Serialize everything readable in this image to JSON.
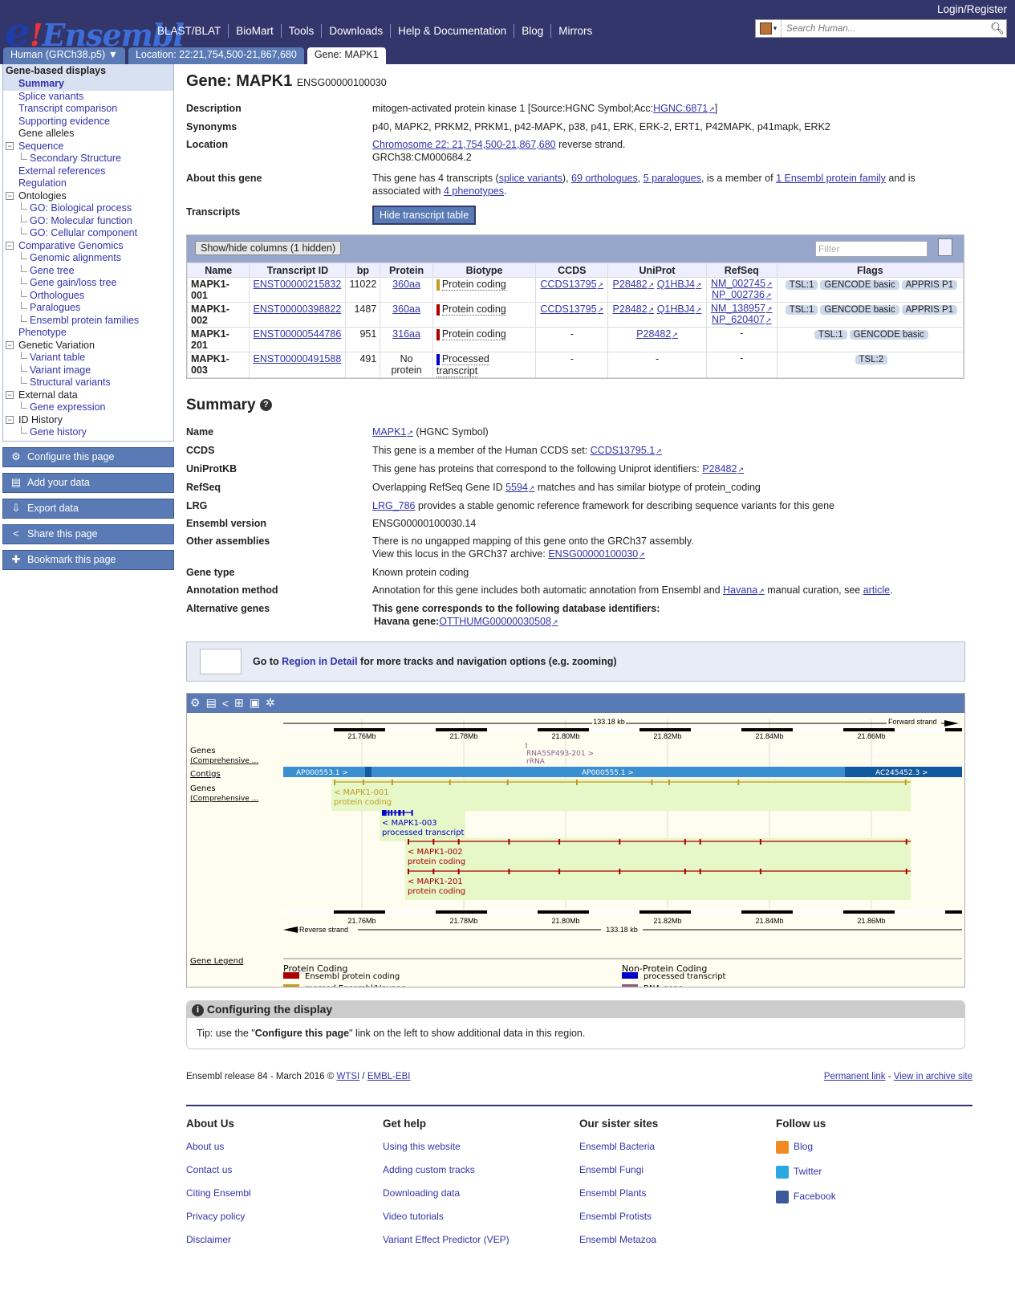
{
  "header": {
    "logo_e": "e",
    "logo_bang": "!",
    "logo_text": "Ensembl",
    "login": "Login/Register",
    "search_placeholder": "Search Human...",
    "nav": [
      "BLAST/BLAT",
      "BioMart",
      "Tools",
      "Downloads",
      "Help & Documentation",
      "Blog",
      "Mirrors"
    ],
    "tabs": [
      "Human (GRCh38.p5) ▼",
      "Location: 22:21,754,500-21,867,680",
      "Gene: MAPK1"
    ]
  },
  "sidebar": {
    "heading": "Gene-based displays",
    "items": [
      {
        "label": "Summary",
        "level": 1,
        "selected": true
      },
      {
        "label": "Splice variants",
        "level": 1
      },
      {
        "label": "Transcript comparison",
        "level": 1
      },
      {
        "label": "Supporting evidence",
        "level": 1
      },
      {
        "label": "Gene alleles",
        "level": 1,
        "plain": true
      },
      {
        "label": "Sequence",
        "level": 1,
        "toggle": "−"
      },
      {
        "label": "Secondary Structure",
        "level": 2,
        "plain": true
      },
      {
        "label": "External references",
        "level": 1
      },
      {
        "label": "Regulation",
        "level": 1
      },
      {
        "label": "Ontologies",
        "level": 1,
        "toggle": "−",
        "plain": true
      },
      {
        "label": "GO: Biological process",
        "level": 2
      },
      {
        "label": "GO: Molecular function",
        "level": 2
      },
      {
        "label": "GO: Cellular component",
        "level": 2
      },
      {
        "label": "Comparative Genomics",
        "level": 1,
        "toggle": "−"
      },
      {
        "label": "Genomic alignments",
        "level": 2
      },
      {
        "label": "Gene tree",
        "level": 2
      },
      {
        "label": "Gene gain/loss tree",
        "level": 2
      },
      {
        "label": "Orthologues",
        "level": 2
      },
      {
        "label": "Paralogues",
        "level": 2
      },
      {
        "label": "Ensembl protein families",
        "level": 2
      },
      {
        "label": "Phenotype",
        "level": 1
      },
      {
        "label": "Genetic Variation",
        "level": 1,
        "toggle": "−",
        "plain": true
      },
      {
        "label": "Variant table",
        "level": 2
      },
      {
        "label": "Variant image",
        "level": 2
      },
      {
        "label": "Structural variants",
        "level": 2
      },
      {
        "label": "External data",
        "level": 1,
        "toggle": "−",
        "plain": true
      },
      {
        "label": "Gene expression",
        "level": 2
      },
      {
        "label": "ID History",
        "level": 1,
        "toggle": "−",
        "plain": true
      },
      {
        "label": "Gene history",
        "level": 2
      }
    ],
    "buttons": [
      {
        "label": "Configure this page",
        "icon": "⚙"
      },
      {
        "label": "Add your data",
        "icon": "▤"
      },
      {
        "label": "Export data",
        "icon": "⇩"
      },
      {
        "label": "Share this page",
        "icon": "<"
      },
      {
        "label": "Bookmark this page",
        "icon": "✚"
      }
    ]
  },
  "gene": {
    "title": "Gene: MAPK1",
    "id": "ENSG00000100030",
    "description_text": "mitogen-activated protein kinase 1 [Source:HGNC Symbol;Acc:",
    "description_link": "HGNC:6871",
    "description_end": "]",
    "synonyms": "p40, MAPK2, PRKM2, PRKM1, p42-MAPK, p38, p41, ERK, ERK-2, ERT1, P42MAPK, p41mapk, ERK2",
    "location_link": "Chromosome 22: 21,754,500-21,867,680",
    "location_strand": " reverse strand.",
    "assembly": "GRCh38:CM000684.2",
    "about_1": "This gene has 4 transcripts (",
    "about_splice": "splice variants",
    "about_2": "), ",
    "about_orth": "69 orthologues",
    "about_3": ", ",
    "about_para": "5 paralogues",
    "about_4": ", is a member of ",
    "about_fam": "1 Ensembl protein family",
    "about_5": " and is associated with ",
    "about_pheno": "4 phenotypes",
    "about_6": ".",
    "hide_btn": "Hide transcript table"
  },
  "labels": {
    "description": "Description",
    "synonyms": "Synonyms",
    "location": "Location",
    "about": "About this gene",
    "transcripts": "Transcripts"
  },
  "transcript_table": {
    "showhide": "Show/hide columns (1 hidden)",
    "filter": "Filter",
    "columns": [
      "Name",
      "Transcript ID",
      "bp",
      "Protein",
      "Biotype",
      "CCDS",
      "UniProt",
      "RefSeq",
      "Flags"
    ],
    "rows": [
      {
        "name": "MAPK1-001",
        "tid": "ENST00000215832",
        "bp": "11022",
        "protein": "360aa",
        "biotype": "Protein coding",
        "color": "#c59a1e",
        "ccds": "CCDS13795",
        "uniprot": [
          "P28482",
          "Q1HBJ4"
        ],
        "refseq": [
          "NM_002745",
          "NP_002736"
        ],
        "flags": [
          "TSL:1",
          "GENCODE basic",
          "APPRIS P1"
        ]
      },
      {
        "name": "MAPK1-002",
        "tid": "ENST00000398822",
        "bp": "1487",
        "protein": "360aa",
        "biotype": "Protein coding",
        "color": "#a00",
        "ccds": "CCDS13795",
        "uniprot": [
          "P28482",
          "Q1HBJ4"
        ],
        "refseq": [
          "NM_138957",
          "NP_620407"
        ],
        "flags": [
          "TSL:1",
          "GENCODE basic",
          "APPRIS P1"
        ]
      },
      {
        "name": "MAPK1-201",
        "tid": "ENST00000544786",
        "bp": "951",
        "protein": "316aa",
        "biotype": "Protein coding",
        "color": "#a00",
        "ccds": "-",
        "uniprot": [
          "P28482"
        ],
        "refseq": [
          "-"
        ],
        "flags": [
          "TSL:1",
          "GENCODE basic"
        ]
      },
      {
        "name": "MAPK1-003",
        "tid": "ENST00000491588",
        "bp": "491",
        "protein": "No protein",
        "biotype": "Processed transcript",
        "color": "#00c",
        "ccds": "-",
        "uniprot": [
          "-"
        ],
        "refseq": [
          "-"
        ],
        "flags": [
          "TSL:2"
        ]
      }
    ]
  },
  "summary": {
    "heading": "Summary",
    "rows": {
      "name_label": "Name",
      "name_link": "MAPK1",
      "name_rest": " (HGNC Symbol)",
      "ccds_label": "CCDS",
      "ccds_text": "This gene is a member of the Human CCDS set: ",
      "ccds_link": "CCDS13795.1",
      "uniprot_label": "UniProtKB",
      "uniprot_text": "This gene has proteins that correspond to the following Uniprot identifiers: ",
      "uniprot_link": "P28482",
      "refseq_label": "RefSeq",
      "refseq_text": "Overlapping RefSeq Gene ID ",
      "refseq_link": "5594",
      "refseq_rest": " matches and has similar biotype of protein_coding",
      "lrg_label": "LRG",
      "lrg_link": "LRG_786",
      "lrg_rest": " provides a stable genomic reference framework for describing sequence variants for this gene",
      "ver_label": "Ensembl version",
      "ver_text": "ENSG00000100030.14",
      "other_label": "Other assemblies",
      "other_text": "There is no ungapped mapping of this gene onto the GRCh37 assembly.",
      "other_text2": "View this locus in the GRCh37 archive: ",
      "other_link": "ENSG00000100030",
      "type_label": "Gene type",
      "type_text": "Known protein coding",
      "ann_label": "Annotation method",
      "ann_text": "Annotation for this gene includes both automatic annotation from Ensembl and ",
      "ann_link": "Havana",
      "ann_text2": " manual curation, see ",
      "ann_link2": "article",
      "ann_end": ".",
      "alt_label": "Alternative genes",
      "alt_text": "This gene corresponds to the following database identifiers:",
      "alt_havana": "Havana gene:",
      "alt_link": "OTTHUMG00000030508"
    }
  },
  "region": {
    "go": "Go to ",
    "link": "Region in Detail",
    "rest": " for more tracks and navigation options (e.g. zooming)"
  },
  "genome_view": {
    "scale_label": "133.18 kb",
    "forward": "Forward strand",
    "reverse": "Reverse strand",
    "ticks": [
      "21.76Mb",
      "21.78Mb",
      "21.80Mb",
      "21.82Mb",
      "21.84Mb",
      "21.86Mb"
    ],
    "track_genes": "Genes\n(Comprehensive ...",
    "track_contigs": "Contigs",
    "contigs": [
      "AP000553.1 >",
      "AP000555.1 >",
      "AC245452.3 >"
    ],
    "rrna": [
      "RNA5SP493-201 >",
      "rRNA"
    ],
    "transcripts": [
      {
        "name": "< MAPK1-001",
        "type": "protein coding",
        "color": "#c59a1e"
      },
      {
        "name": "< MAPK1-003",
        "type": "processed transcript",
        "color": "#00c"
      },
      {
        "name": "< MAPK1-002",
        "type": "protein coding",
        "color": "#a00"
      },
      {
        "name": "< MAPK1-201",
        "type": "protein coding",
        "color": "#a00"
      }
    ],
    "legend_title": "Gene Legend",
    "legend_pc": "Protein Coding",
    "legend_npc": "Non-Protein Coding",
    "legend_items": [
      {
        "label": "Ensembl protein coding",
        "color": "#a00"
      },
      {
        "label": "merged Ensembl/Havana",
        "color": "#c59a1e"
      },
      {
        "label": "processed transcript",
        "color": "#00c"
      },
      {
        "label": "RNA gene",
        "color": "#8a5c8a"
      }
    ]
  },
  "config_box": {
    "heading": "Configuring the display",
    "tip_1": "Tip: use the \"",
    "tip_bold": "Configure this page",
    "tip_2": "\" link on the left to show additional data in this region."
  },
  "release": {
    "text": "Ensembl release 84 - March 2016 © ",
    "wtsi": "WTSI",
    "sep": " / ",
    "ebi": "EMBL-EBI",
    "perm": "Permanent link",
    "dash": " - ",
    "archive": "View in archive site"
  },
  "footer": [
    {
      "heading": "About Us",
      "links": [
        "About us",
        "Contact us",
        "Citing Ensembl",
        "Privacy policy",
        "Disclaimer"
      ]
    },
    {
      "heading": "Get help",
      "links": [
        "Using this website",
        "Adding custom tracks",
        "Downloading data",
        "Video tutorials",
        "Variant Effect Predictor (VEP)"
      ]
    },
    {
      "heading": "Our sister sites",
      "links": [
        "Ensembl Bacteria",
        "Ensembl Fungi",
        "Ensembl Plants",
        "Ensembl Protists",
        "Ensembl Metazoa"
      ]
    },
    {
      "heading": "Follow us",
      "links": [
        "Blog",
        "Twitter",
        "Facebook"
      ]
    }
  ]
}
